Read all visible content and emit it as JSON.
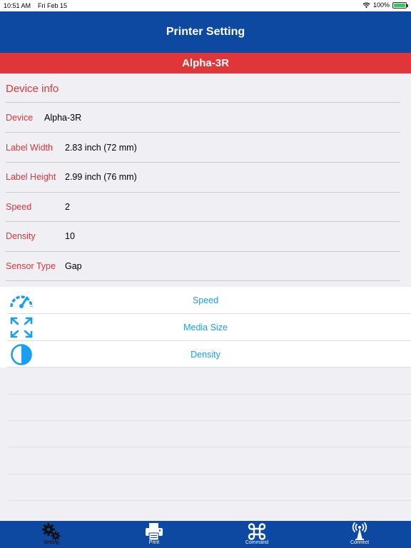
{
  "status_bar": {
    "time": "10:51 AM",
    "date": "Fri Feb 15",
    "battery": "100%"
  },
  "nav": {
    "title": "Printer Setting"
  },
  "device_bar": {
    "name": "Alpha-3R"
  },
  "device_info": {
    "header": "Device info",
    "rows": [
      {
        "label": "Device",
        "value": "Alpha-3R"
      },
      {
        "label": "Label Width",
        "value": "2.83 inch (72 mm)"
      },
      {
        "label": "Label Height",
        "value": "2.99 inch (76 mm)"
      },
      {
        "label": "Speed",
        "value": "2"
      },
      {
        "label": "Density",
        "value": "10"
      },
      {
        "label": "Sensor Type",
        "value": "Gap"
      }
    ]
  },
  "menu": [
    {
      "label": "Speed",
      "icon": "speedometer-icon"
    },
    {
      "label": "Media Size",
      "icon": "expand-arrows-icon"
    },
    {
      "label": "Density",
      "icon": "contrast-icon"
    }
  ],
  "tabs": [
    {
      "label": "Setting",
      "icon": "gears-icon",
      "active": true
    },
    {
      "label": "Print",
      "icon": "printer-icon",
      "active": false
    },
    {
      "label": "Command",
      "icon": "command-icon",
      "active": false
    },
    {
      "label": "Connect",
      "icon": "antenna-icon",
      "active": false
    }
  ],
  "colors": {
    "nav_blue": "#0d49a0",
    "accent_red": "#e0363a",
    "link_blue": "#1a9ef0",
    "battery_green": "#34c759"
  }
}
